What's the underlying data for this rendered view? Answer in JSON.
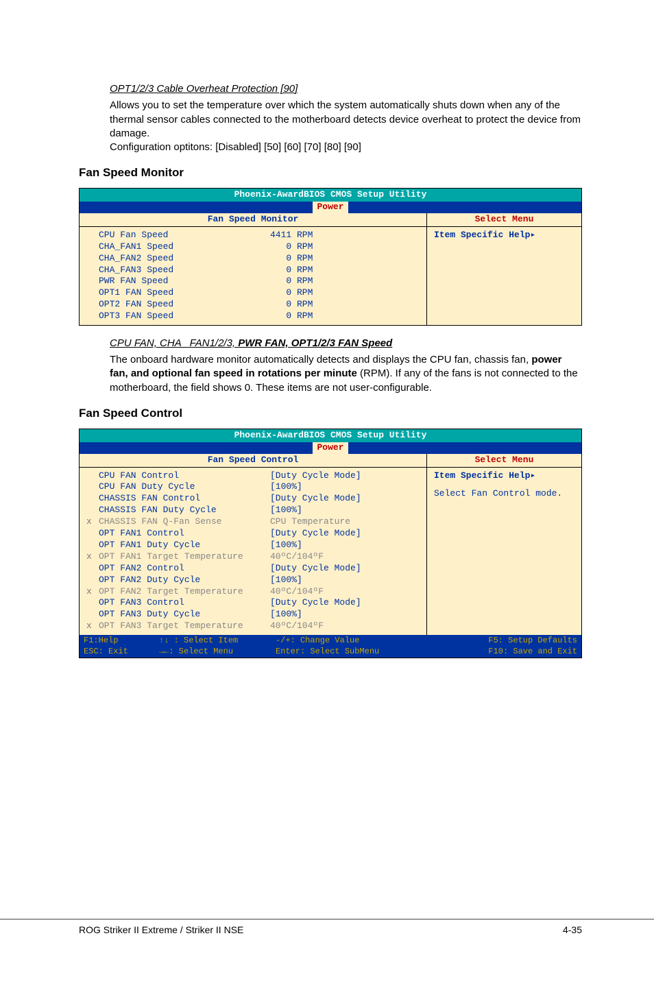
{
  "section1": {
    "title": "OPT1/2/3 Cable Overheat Protection [90]",
    "para": "Allows you to set the temperature over which the system automatically shuts down when any of the thermal sensor cables connected to the motherboard detects device overheat to protect the device from damage.",
    "config": "Configuration optitons: [Disabled] [50] [60] [70] [80] [90]"
  },
  "heading1": "Fan Speed Monitor",
  "bios_monitor": {
    "title": "Phoenix-AwardBIOS CMOS Setup Utility",
    "tab": "Power",
    "subleft": "Fan Speed Monitor",
    "subright": "Select Menu",
    "help": "Item Specific Help",
    "rows": [
      {
        "pfx": "",
        "lbl": "CPU Fan Speed",
        "val": "4411 RPM"
      },
      {
        "pfx": "",
        "lbl": "CHA_FAN1 Speed",
        "val": "   0 RPM"
      },
      {
        "pfx": "",
        "lbl": "CHA_FAN2 Speed",
        "val": "   0 RPM"
      },
      {
        "pfx": "",
        "lbl": "CHA_FAN3 Speed",
        "val": "   0 RPM"
      },
      {
        "pfx": "",
        "lbl": "PWR FAN Speed",
        "val": "   0 RPM"
      },
      {
        "pfx": "",
        "lbl": "OPT1 FAN Speed",
        "val": "   0 RPM"
      },
      {
        "pfx": "",
        "lbl": "OPT2 FAN Speed",
        "val": "   0 RPM"
      },
      {
        "pfx": "",
        "lbl": "OPT3 FAN Speed",
        "val": "   0 RPM"
      }
    ]
  },
  "section2": {
    "title_part1": "CPU FAN, CHA _FAN1/2/3, ",
    "title_part2": "PWR FAN, OPT1/2/3 FAN Speed",
    "p1a": "The onboard hardware monitor automatically detects and displays the CPU fan, chassis fan, ",
    "p1b": "power fan, and optional fan speed in rotations per minute",
    "p1c": " (RPM). If any of the fans is not connected to the motherboard, the field shows 0. These items are not user-configurable."
  },
  "heading2": "Fan Speed Control",
  "bios_control": {
    "title": "Phoenix-AwardBIOS CMOS Setup Utility",
    "tab": "Power",
    "subleft": "Fan Speed Control",
    "subright": "Select Menu",
    "help1": "Item Specific Help",
    "help2": "Select Fan Control mode.",
    "rows": [
      {
        "pfx": "",
        "lbl": "CPU FAN Control",
        "val": "[Duty Cycle Mode]",
        "dim": false
      },
      {
        "pfx": "",
        "lbl": "CPU FAN Duty Cycle",
        "val": "[100%]",
        "dim": false
      },
      {
        "pfx": "",
        "lbl": "CHASSIS FAN Control",
        "val": "[Duty Cycle Mode]",
        "dim": false
      },
      {
        "pfx": "",
        "lbl": "CHASSIS FAN Duty Cycle",
        "val": "[100%]",
        "dim": false
      },
      {
        "pfx": "x",
        "lbl": "CHASSIS FAN Q-Fan Sense",
        "val": "CPU Temperature",
        "dim": true
      },
      {
        "pfx": "",
        "lbl": "OPT FAN1 Control",
        "val": "[Duty Cycle Mode]",
        "dim": false
      },
      {
        "pfx": "",
        "lbl": "OPT FAN1 Duty Cycle",
        "val": "[100%]",
        "dim": false
      },
      {
        "pfx": "x",
        "lbl": "OPT FAN1 Target Temperature",
        "val": "40ºC/104ºF",
        "dim": true
      },
      {
        "pfx": "",
        "lbl": "OPT FAN2 Control",
        "val": "[Duty Cycle Mode]",
        "dim": false
      },
      {
        "pfx": "",
        "lbl": "OPT FAN2 Duty Cycle",
        "val": "[100%]",
        "dim": false
      },
      {
        "pfx": "x",
        "lbl": "OPT FAN2 Target Temperature",
        "val": "40ºC/104ºF",
        "dim": true
      },
      {
        "pfx": "",
        "lbl": "OPT FAN3 Control",
        "val": "[Duty Cycle Mode]",
        "dim": false
      },
      {
        "pfx": "",
        "lbl": "OPT FAN3 Duty Cycle",
        "val": "[100%]",
        "dim": false
      },
      {
        "pfx": "x",
        "lbl": "OPT FAN3 Target Temperature",
        "val": "40ºC/104ºF",
        "dim": true
      }
    ],
    "footer": {
      "c1a": "F1:Help",
      "c1b": "ESC: Exit",
      "c2a": "↑↓ : Select Item",
      "c2b": "→←: Select Menu",
      "c3a": "-/+: Change Value",
      "c3b": "Enter: Select SubMenu",
      "c4a": "F5: Setup Defaults",
      "c4b": "F10: Save and Exit"
    }
  },
  "page_footer": {
    "left": "ROG Striker II Extreme / Striker II NSE",
    "right": "4-35"
  }
}
